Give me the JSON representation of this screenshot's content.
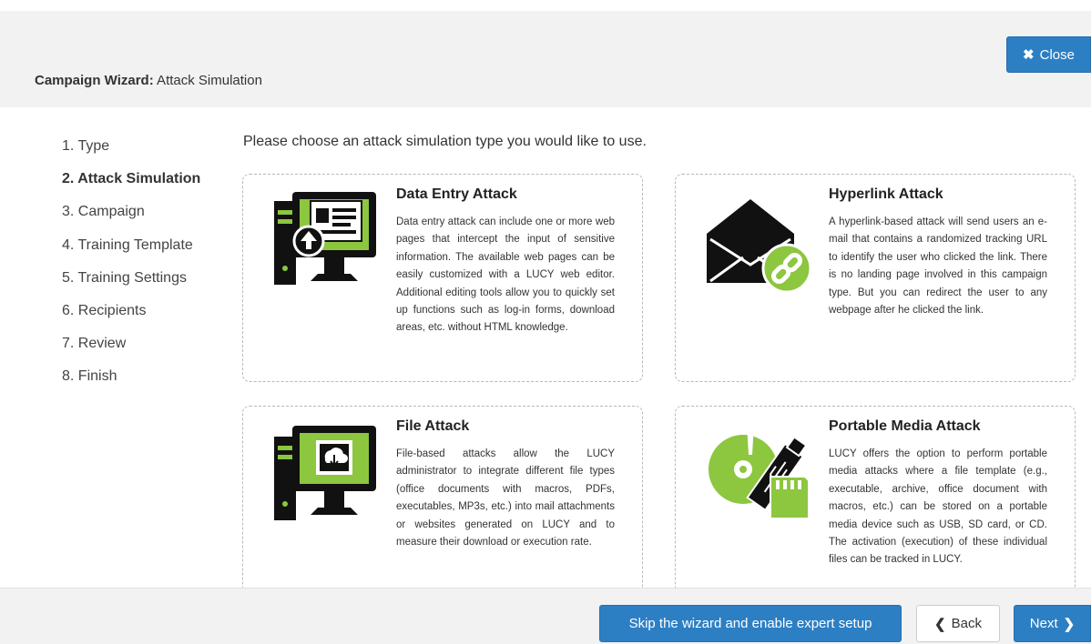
{
  "header": {
    "title_bold": "Campaign Wizard:",
    "title_rest": " Attack Simulation",
    "close_label": "Close"
  },
  "steps": [
    {
      "label": "1. Type"
    },
    {
      "label": "2. Attack Simulation",
      "active": true
    },
    {
      "label": "3. Campaign"
    },
    {
      "label": "4. Training Template"
    },
    {
      "label": "5. Training Settings"
    },
    {
      "label": "6. Recipients"
    },
    {
      "label": "7. Review"
    },
    {
      "label": "8. Finish"
    }
  ],
  "intro": "Please choose an attack simulation type you would like to use.",
  "cards": [
    {
      "title": "Data Entry Attack",
      "description": "Data entry attack can include one or more web pages that intercept the input of sensitive information. The available web pages can be easily customized with a LUCY web editor. Additional editing tools allow you to quickly set up functions such as log-in forms, download areas, etc. without HTML knowledge.",
      "icon": "computer-upload-icon"
    },
    {
      "title": "Hyperlink Attack",
      "description": "A hyperlink-based attack will send users an e-mail that contains a randomized tracking URL to identify the user who clicked the link. There is no landing page involved in this campaign type. But you can redirect the user to any webpage after he clicked the link.",
      "icon": "envelope-link-icon"
    },
    {
      "title": "File Attack",
      "description": "File-based attacks allow the LUCY administrator to integrate different file types (office documents with macros, PDFs, executables, MP3s, etc.) into mail attachments or websites generated on LUCY and to measure their download or execution rate.",
      "icon": "computer-download-icon"
    },
    {
      "title": "Portable Media Attack",
      "description": "LUCY offers the option to perform portable media attacks where a file template (e.g., executable, archive, office document with macros, etc.) can be stored on a portable media device such as USB, SD card, or CD. The activation (execution) of these individual files can be tracked in LUCY.",
      "icon": "portable-media-icon"
    }
  ],
  "footer": {
    "skip_label": "Skip the wizard and enable expert setup",
    "back_label": "Back",
    "next_label": "Next"
  },
  "colors": {
    "accent_green": "#8dc63f",
    "primary_blue": "#2d7fc4",
    "icon_black": "#111111"
  }
}
